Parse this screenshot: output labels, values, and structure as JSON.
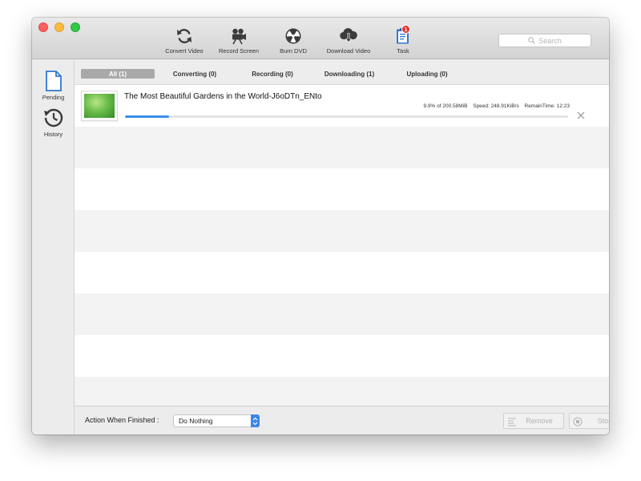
{
  "toolbar": {
    "convert_video": "Convert Video",
    "record_screen": "Record Screen",
    "burn_dvd": "Burn DVD",
    "download_video": "Download Video",
    "task": "Task",
    "task_badge": "1"
  },
  "search": {
    "placeholder": "Search"
  },
  "sidebar": {
    "pending": "Pending",
    "history": "History"
  },
  "tabs": {
    "all": "All (1)",
    "converting": "Converting (0)",
    "recording": "Recording (0)",
    "downloading": "Downloading (1)",
    "uploading": "Uploading (0)"
  },
  "task_item": {
    "title": "The Most Beautiful Gardens in the World-J6oDTn_ENto",
    "progress_text": "9.9% of 200.58MiB",
    "speed": "Speed: 248.91KiB/s",
    "remain": "RemainTime: 12:23",
    "progress_fraction": 0.099
  },
  "footer": {
    "action_label": "Action When Finished :",
    "action_value": "Do Nothing",
    "remove": "Remove",
    "stop": "Stop"
  },
  "colors": {
    "accent": "#3a8fe8",
    "badge": "#e4322b",
    "active_tab": "#a9a9a9"
  }
}
